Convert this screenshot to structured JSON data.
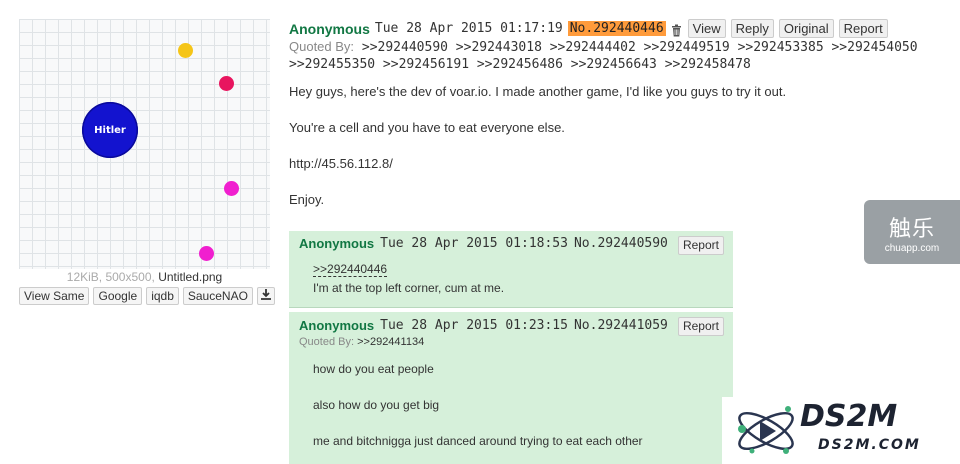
{
  "thumbnail": {
    "cell_label": "Hitler",
    "file_size_dims": "12KiB, 500x500,",
    "file_name": "Untitled.png",
    "tools": [
      "View Same",
      "Google",
      "iqdb",
      "SauceNAO"
    ],
    "download_icon": "download-icon",
    "cell_colors": {
      "hitler": "#1313cf",
      "yellow": "#f5c518",
      "magenta": "#f0217f",
      "pink": "#f01fcf"
    }
  },
  "op": {
    "name": "Anonymous",
    "datetime": "Tue 28 Apr 2015 01:17:19",
    "post_no": "No.292440446",
    "trash_icon": "trash-icon",
    "buttons": {
      "view": "View",
      "reply": "Reply",
      "original": "Original",
      "report": "Report"
    },
    "quoted_by_label": "Quoted By:",
    "quoted_by": [
      ">>292440590",
      ">>292443018",
      ">>292444402",
      ">>292449519",
      ">>292453385",
      ">>292454050",
      ">>292455350",
      ">>292456191",
      ">>292456486",
      ">>292456643",
      ">>292458478"
    ],
    "body": [
      "Hey guys, here's the dev of voar.io. I made another game, I'd like you guys to try it out.",
      "You're a cell and you have to eat everyone else.",
      "http://45.56.112.8/",
      "Enjoy."
    ],
    "highlight_color": "#ff9b3b"
  },
  "replies": [
    {
      "name": "Anonymous",
      "datetime": "Tue 28 Apr 2015 01:18:53",
      "post_no": "No.292440590",
      "report": "Report",
      "quote": ">>292440446",
      "body": [
        "I'm at the top left corner, cum at me."
      ]
    },
    {
      "name": "Anonymous",
      "datetime": "Tue 28 Apr 2015 01:23:15",
      "post_no": "No.292441059",
      "report": "Report",
      "quoted_by_label": "Quoted By:",
      "quoted_by": ">>292441134",
      "body": [
        "how do you eat people",
        "also how do you get big",
        "me and bitchnigga just danced around trying to eat each other"
      ]
    }
  ],
  "watermarks": {
    "chuapp_big": "触乐",
    "chuapp_small": "chuapp.com",
    "ds2m_big": "DS2M",
    "ds2m_small": "DS2M.COM"
  },
  "colors": {
    "name_green": "#117743",
    "reply_bg": "#d6f0da"
  }
}
